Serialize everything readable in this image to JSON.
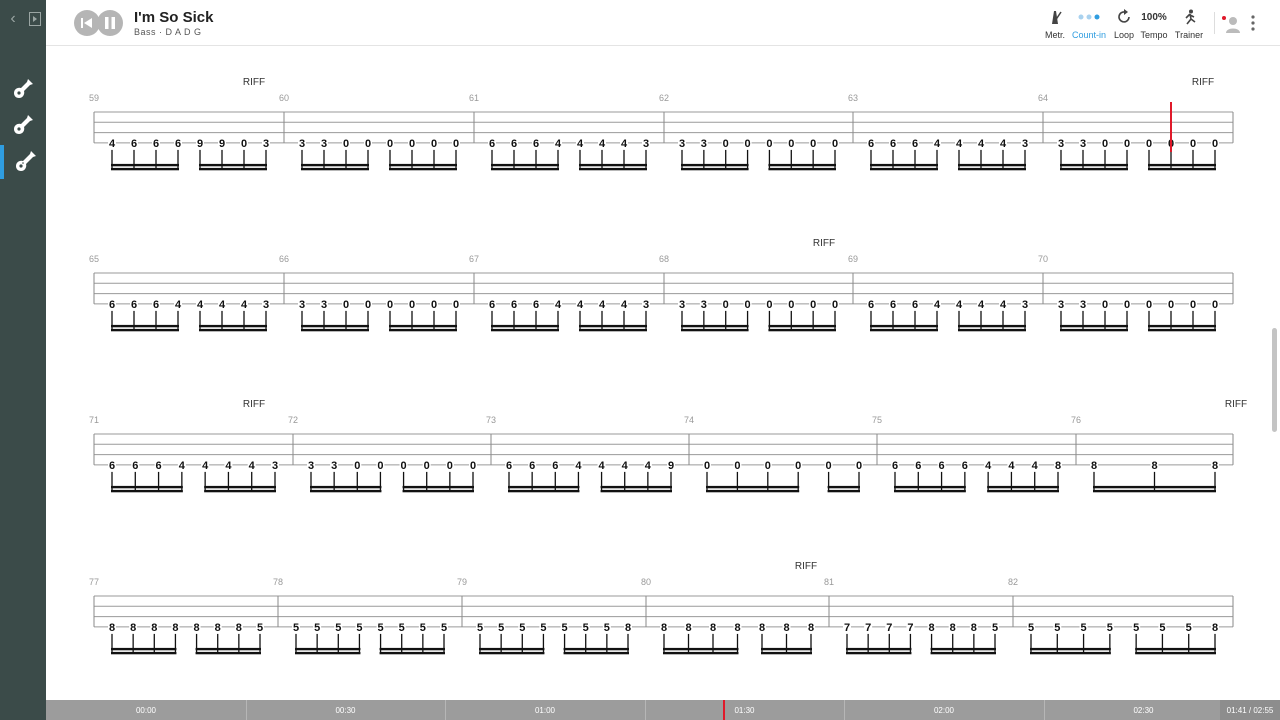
{
  "song": {
    "title": "I'm So Sick",
    "subtitle": "Bass · D A D G"
  },
  "toolbar": {
    "metronome": "Metr.",
    "count_in": "Count-in",
    "loop": "Loop",
    "tempo_value": "100%",
    "tempo": "Tempo",
    "trainer": "Trainer"
  },
  "timeline": {
    "ticks": [
      "00:00",
      "00:30",
      "01:00",
      "01:30",
      "02:00",
      "02:30"
    ],
    "position": "01:41 / 02:55",
    "played_fraction": 0.577
  },
  "colors": {
    "sidebar": "#3b4b49",
    "accent": "#2f9de0",
    "cursor": "#e0192a",
    "timeline": "#9c9c9c"
  },
  "tab": {
    "section_label": "RIFF",
    "systems": [
      {
        "measures": [
          {
            "number": "59",
            "riff": true,
            "notes": [
              "4",
              "6",
              "6",
              "6",
              "9",
              "9",
              "0",
              "3"
            ]
          },
          {
            "number": "60",
            "notes": [
              "3",
              "3",
              "0",
              "0",
              "0",
              "0",
              "0",
              "0"
            ]
          },
          {
            "number": "61",
            "notes": [
              "6",
              "6",
              "6",
              "4",
              "4",
              "4",
              "4",
              "3"
            ]
          },
          {
            "number": "62",
            "notes": [
              "3",
              "3",
              "0",
              "0",
              "0",
              "0",
              "0",
              "0"
            ]
          },
          {
            "number": "63",
            "notes": [
              "6",
              "6",
              "6",
              "4",
              "4",
              "4",
              "4",
              "3"
            ]
          },
          {
            "number": "64",
            "riff": true,
            "notes": [
              "3",
              "3",
              "0",
              "0",
              "0",
              "0",
              "0",
              "0"
            ]
          }
        ]
      },
      {
        "measures": [
          {
            "number": "65",
            "notes": [
              "6",
              "6",
              "6",
              "4",
              "4",
              "4",
              "4",
              "3"
            ]
          },
          {
            "number": "66",
            "notes": [
              "3",
              "3",
              "0",
              "0",
              "0",
              "0",
              "0",
              "0"
            ]
          },
          {
            "number": "67",
            "notes": [
              "6",
              "6",
              "6",
              "4",
              "4",
              "4",
              "4",
              "3"
            ]
          },
          {
            "number": "68",
            "riff": true,
            "notes": [
              "3",
              "3",
              "0",
              "0",
              "0",
              "0",
              "0",
              "0"
            ]
          },
          {
            "number": "69",
            "notes": [
              "6",
              "6",
              "6",
              "4",
              "4",
              "4",
              "4",
              "3"
            ]
          },
          {
            "number": "70",
            "notes": [
              "3",
              "3",
              "0",
              "0",
              "0",
              "0",
              "0",
              "0"
            ]
          }
        ]
      },
      {
        "measures": [
          {
            "number": "71",
            "riff": true,
            "notes": [
              "6",
              "6",
              "6",
              "4",
              "4",
              "4",
              "4",
              "3"
            ]
          },
          {
            "number": "72",
            "notes": [
              "3",
              "3",
              "0",
              "0",
              "0",
              "0",
              "0",
              "0"
            ]
          },
          {
            "number": "73",
            "notes": [
              "6",
              "6",
              "6",
              "4",
              "4",
              "4",
              "4",
              "9"
            ]
          },
          {
            "number": "74",
            "notes": [
              "0",
              "0",
              "0",
              "0",
              "0",
              "0"
            ]
          },
          {
            "number": "75",
            "notes": [
              "6",
              "6",
              "6",
              "6",
              "4",
              "4",
              "4",
              "8"
            ]
          },
          {
            "number": "76",
            "riff": true,
            "notes": [
              "8",
              "8",
              "8"
            ]
          }
        ]
      },
      {
        "measures": [
          {
            "number": "77",
            "notes": [
              "8",
              "8",
              "8",
              "8",
              "8",
              "8",
              "8",
              "5"
            ]
          },
          {
            "number": "78",
            "notes": [
              "5",
              "5",
              "5",
              "5",
              "5",
              "5",
              "5",
              "5"
            ]
          },
          {
            "number": "79",
            "notes": [
              "5",
              "5",
              "5",
              "5",
              "5",
              "5",
              "5",
              "8"
            ]
          },
          {
            "number": "80",
            "riff": true,
            "notes": [
              "8",
              "8",
              "8",
              "8",
              "8",
              "8",
              "8"
            ]
          },
          {
            "number": "81",
            "notes": [
              "7",
              "7",
              "7",
              "7",
              "8",
              "8",
              "8",
              "5"
            ]
          },
          {
            "number": "82",
            "notes": [
              "5",
              "5",
              "5",
              "5",
              "5",
              "5",
              "5",
              "8"
            ]
          }
        ]
      }
    ]
  }
}
